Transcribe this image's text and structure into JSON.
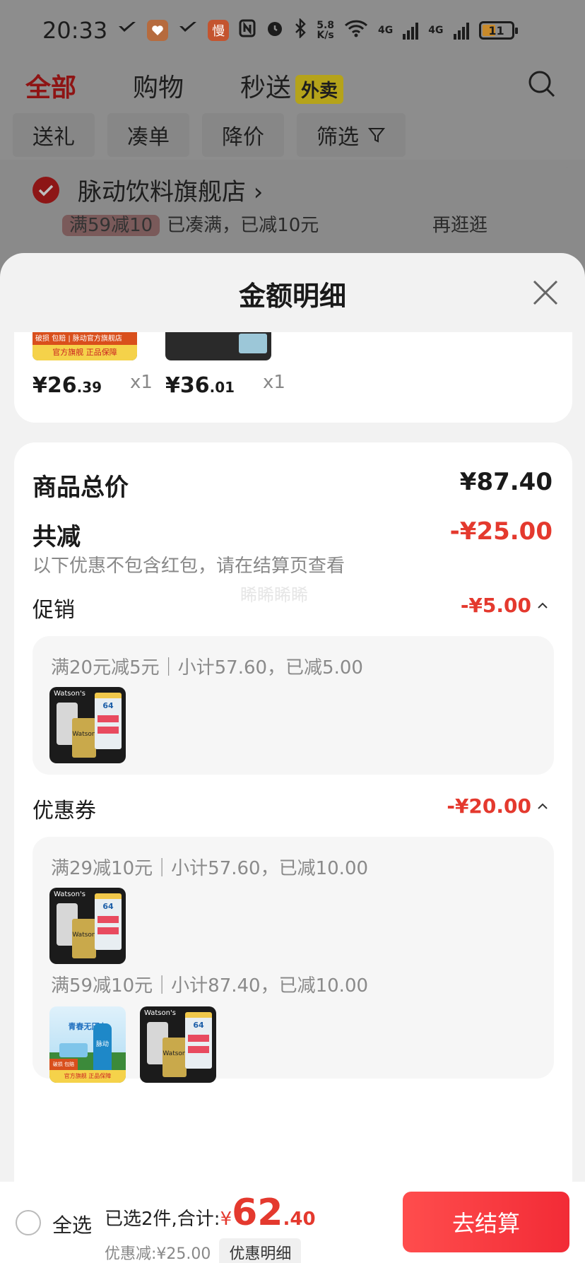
{
  "status_bar": {
    "time": "20:33",
    "net_speed_value": "5.8",
    "net_speed_unit": "K/s",
    "signal_1_label": "4G",
    "signal_2_label": "4G",
    "battery": "11",
    "slow_badge": "慢"
  },
  "top_nav": {
    "tabs": [
      {
        "label": "全部",
        "active": true
      },
      {
        "label": "购物",
        "active": false
      },
      {
        "label": "秒送",
        "active": false
      }
    ],
    "badge": "外卖"
  },
  "filters": [
    "送礼",
    "凑单",
    "降价",
    "筛选"
  ],
  "store": {
    "name": "脉动饮料旗舰店",
    "sub_tag": "满59减10",
    "sub_text": "已凑满，已减10元",
    "sub_right": "再逛逛"
  },
  "sheet": {
    "title": "金额明细",
    "products": [
      {
        "price_int": "¥26",
        "price_dec": ".39",
        "qty": "x1",
        "banner_top": "破损 包赔 | 脉动官方旗舰店",
        "banner_bottom": "官方旗舰 正品保障"
      },
      {
        "price_int": "¥36",
        "price_dec": ".01",
        "qty": "x1"
      }
    ],
    "summary": {
      "total_label": "商品总价",
      "total_value": "¥87.40",
      "reduce_label": "共减",
      "reduce_value": "-¥25.00",
      "note": "以下优惠不包含红包，请在结算页查看",
      "watermark": "睎睎睎睎"
    },
    "promotion": {
      "label": "促销",
      "value": "-¥5.00",
      "rules": [
        {
          "text": "满20元减5元｜小计57.60，已减5.00"
        }
      ]
    },
    "coupon": {
      "label": "优惠券",
      "value": "-¥20.00",
      "rules": [
        {
          "text": "满29减10元｜小计57.60，已减10.00"
        },
        {
          "text": "满59减10元｜小计87.40，已减10.00"
        }
      ]
    },
    "product_image_text": {
      "watsons_logo": "Watson's",
      "watsons_can": "Watson",
      "watsons_badge": "64",
      "pulse_slogan": "青春无压力",
      "pulse_logo": "脉动",
      "pulse_tag": "破损 包赔",
      "pulse_footer": "官方旗舰 正品保障"
    }
  },
  "bottom_bar": {
    "select_all": "全选",
    "selected_text": "已选2件,合计:",
    "currency": "¥",
    "total_int": "62",
    "total_dec": ".40",
    "discount_text": "优惠减:¥25.00",
    "detail_button": "优惠明细",
    "checkout_button": "去结算"
  },
  "colors": {
    "accent_red": "#e4392e",
    "checkout_gradient_start": "#ff4d4d",
    "checkout_gradient_end": "#f22b36"
  }
}
